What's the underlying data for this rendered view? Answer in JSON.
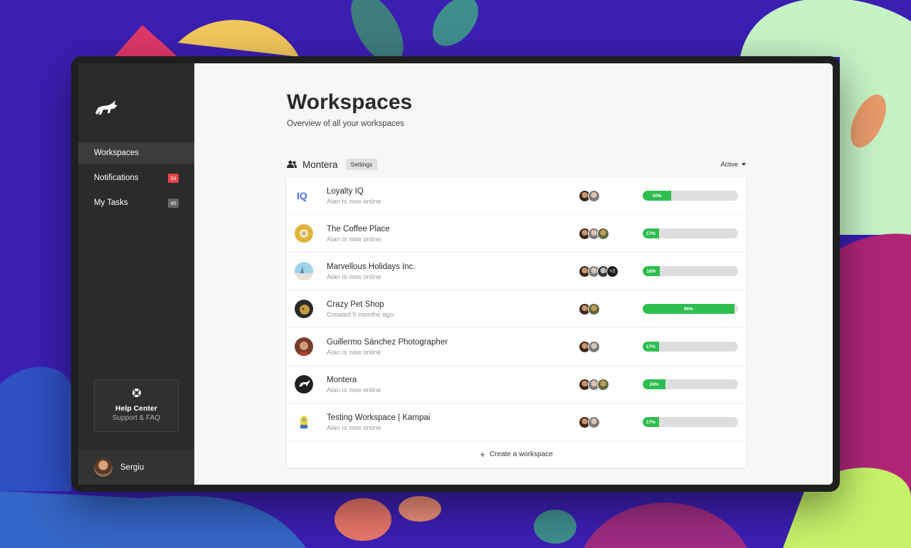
{
  "sidebar": {
    "nav": [
      {
        "label": "Workspaces",
        "active": true
      },
      {
        "label": "Notifications",
        "badge": "34",
        "badge_color": "#e8414b"
      },
      {
        "label": "My Tasks",
        "badge": "45",
        "badge_color": "#666666"
      }
    ],
    "help": {
      "title": "Help Center",
      "subtitle": "Support & FAQ",
      "icon": "lifebuoy-icon"
    },
    "user": {
      "name": "Sergiu"
    }
  },
  "main": {
    "title": "Workspaces",
    "subtitle": "Overview of all your workspaces",
    "group": {
      "name": "Montera",
      "settings_label": "Settings",
      "filter_label": "Active",
      "icon": "users-icon"
    },
    "workspaces": [
      {
        "name": "Loyalty IQ",
        "status": "Alan is now online",
        "progress": 30,
        "progress_label": "30%"
      },
      {
        "name": "The Coffee Place",
        "status": "Alan is now online",
        "progress": 17,
        "progress_label": "17%"
      },
      {
        "name": "Marvellous Holidays Inc.",
        "status": "Alan is now online",
        "progress": 18,
        "progress_label": "18%",
        "more_members": "+2"
      },
      {
        "name": "Crazy Pet Shop",
        "status": "Created 5 months ago",
        "progress": 96,
        "progress_label": "96%"
      },
      {
        "name": "Guillermo Sánchez Photographer",
        "status": "Alan is now online",
        "progress": 17,
        "progress_label": "17%"
      },
      {
        "name": "Montera",
        "status": "Alan is now online",
        "progress": 24,
        "progress_label": "24%"
      },
      {
        "name": "Testing Workspace | Kampai",
        "status": "Alan is now online",
        "progress": 17,
        "progress_label": "17%"
      }
    ],
    "create_label": "Create a workspace"
  },
  "colors": {
    "accent": "#2dbe4f",
    "sidebar": "#2b2b2b",
    "badge_red": "#e8414b"
  }
}
